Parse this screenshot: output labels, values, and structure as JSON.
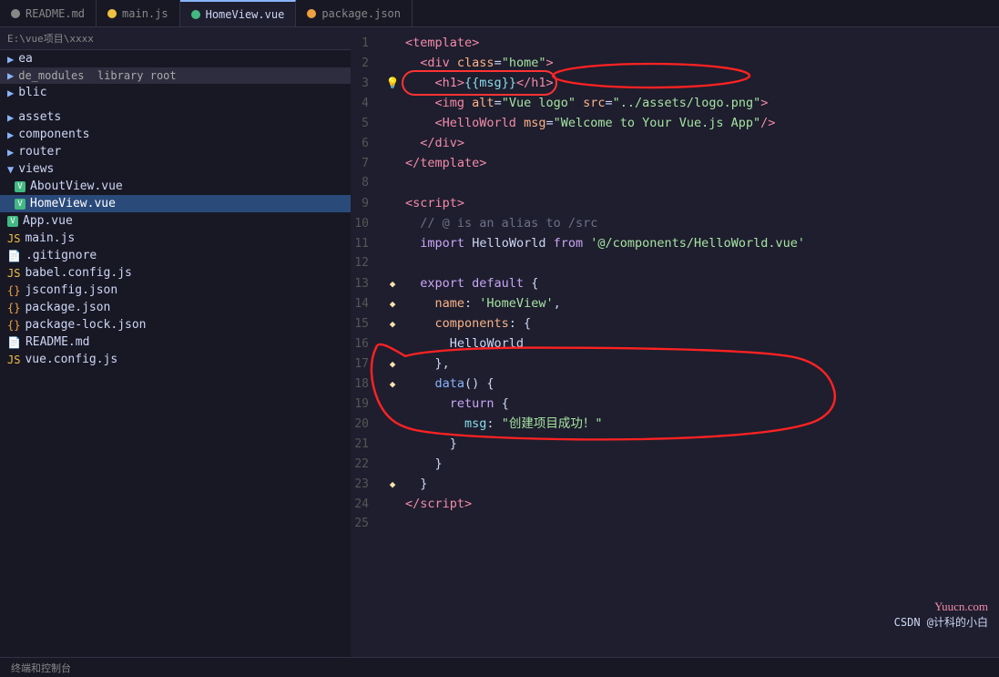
{
  "tabs": [
    {
      "label": "README.md",
      "icon_color": "#888",
      "active": false
    },
    {
      "label": "main.js",
      "icon_color": "#f0c040",
      "active": false
    },
    {
      "label": "HomeView.vue",
      "icon_color": "#42b883",
      "active": true
    },
    {
      "label": "package.json",
      "icon_color": "#f0a040",
      "active": false
    }
  ],
  "sidebar": {
    "path": "E:\\vue项目\\xxxx",
    "items": [
      {
        "label": "ea",
        "indent": 0,
        "type": "folder"
      },
      {
        "label": "de_modules  library root",
        "indent": 0,
        "type": "library"
      },
      {
        "label": "blic",
        "indent": 0,
        "type": "folder"
      },
      {
        "label": "",
        "indent": 0,
        "type": "spacer"
      },
      {
        "label": "assets",
        "indent": 0,
        "type": "folder"
      },
      {
        "label": "components",
        "indent": 0,
        "type": "folder"
      },
      {
        "label": "router",
        "indent": 0,
        "type": "folder"
      },
      {
        "label": "views",
        "indent": 0,
        "type": "folder"
      },
      {
        "label": "AboutView.vue",
        "indent": 1,
        "type": "vue"
      },
      {
        "label": "HomeView.vue",
        "indent": 1,
        "type": "vue",
        "selected": true
      },
      {
        "label": "App.vue",
        "indent": 0,
        "type": "vue"
      },
      {
        "label": "main.js",
        "indent": 0,
        "type": "js"
      },
      {
        "label": ".gitignore",
        "indent": 0,
        "type": "file"
      },
      {
        "label": "babel.config.js",
        "indent": 0,
        "type": "js"
      },
      {
        "label": "jsconfig.json",
        "indent": 0,
        "type": "json"
      },
      {
        "label": "package.json",
        "indent": 0,
        "type": "json"
      },
      {
        "label": "package-lock.json",
        "indent": 0,
        "type": "json"
      },
      {
        "label": "README.md",
        "indent": 0,
        "type": "file"
      },
      {
        "label": "vue.config.js",
        "indent": 0,
        "type": "js"
      }
    ]
  },
  "bottom_bar": {
    "left_items": [
      "终端和控制台"
    ],
    "watermark_url": "Yuucn.com",
    "watermark_author": "CSDN @计科的小白"
  },
  "code": {
    "lines": [
      {
        "num": 1,
        "content_html": "<span class='c-tag'>&lt;template&gt;</span>"
      },
      {
        "num": 2,
        "content_html": "  <span class='c-tag'>&lt;div</span> <span class='c-attr'>class</span>=<span class='c-str'>\"home\"</span><span class='c-tag'>&gt;</span>"
      },
      {
        "num": 3,
        "content_html": "    <span class='c-tag'>&lt;h1&gt;</span><span class='c-bracket'>{{</span><span class='c-prop'>msg</span><span class='c-bracket'>}}</span><span class='c-tag'>&lt;/h1&gt;</span>",
        "highlight_oval": true,
        "lightbulb": true
      },
      {
        "num": 4,
        "content_html": "    <span class='c-tag'>&lt;img</span> <span class='c-attr'>alt</span>=<span class='c-str'>\"Vue logo\"</span> <span class='c-attr'>src</span>=<span class='c-str'>\"../assets/logo.png\"</span><span class='c-tag'>&gt;</span>"
      },
      {
        "num": 5,
        "content_html": "    <span class='c-tag'>&lt;HelloWorld</span> <span class='c-attr'>msg</span>=<span class='c-str'>\"Welcome to Your Vue.js App\"</span><span class='c-tag'>/&gt;</span>"
      },
      {
        "num": 6,
        "content_html": "  <span class='c-tag'>&lt;/div&gt;</span>"
      },
      {
        "num": 7,
        "content_html": "<span class='c-tag'>&lt;/template&gt;</span>"
      },
      {
        "num": 8,
        "content_html": ""
      },
      {
        "num": 9,
        "content_html": "<span class='c-tag'>&lt;script&gt;</span>"
      },
      {
        "num": 10,
        "content_html": "  <span class='c-comment'>// @ is an alias to /src</span>"
      },
      {
        "num": 11,
        "content_html": "  <span class='c-kw'>import</span> <span class='c-plain'>HelloWorld</span> <span class='c-kw'>from</span> <span class='c-str'>'@/components/HelloWorld.vue'</span>"
      },
      {
        "num": 12,
        "content_html": ""
      },
      {
        "num": 13,
        "content_html": "  <span class='c-kw'>export default</span> {",
        "gutter": "◆"
      },
      {
        "num": 14,
        "content_html": "    <span class='c-attr'>name</span>: <span class='c-str'>'HomeView'</span>,",
        "gutter": "◆"
      },
      {
        "num": 15,
        "content_html": "    <span class='c-attr'>components</span>: {",
        "gutter": "◆"
      },
      {
        "num": 16,
        "content_html": "      <span class='c-plain'>HelloWorld</span>"
      },
      {
        "num": 17,
        "content_html": "    },",
        "gutter": "◆"
      },
      {
        "num": 18,
        "content_html": "    <span class='c-fn'>data</span>() {",
        "gutter": "◆"
      },
      {
        "num": 19,
        "content_html": "      <span class='c-kw'>return</span> {"
      },
      {
        "num": 20,
        "content_html": "        <span class='c-prop'>msg</span>: <span class='c-str'>\"创建项目成功！\"</span>"
      },
      {
        "num": 21,
        "content_html": "      }"
      },
      {
        "num": 22,
        "content_html": "    }"
      },
      {
        "num": 23,
        "content_html": "  }",
        "gutter": "◆"
      },
      {
        "num": 24,
        "content_html": "<span class='c-tag'>&lt;/script&gt;</span>"
      },
      {
        "num": 25,
        "content_html": ""
      }
    ]
  }
}
